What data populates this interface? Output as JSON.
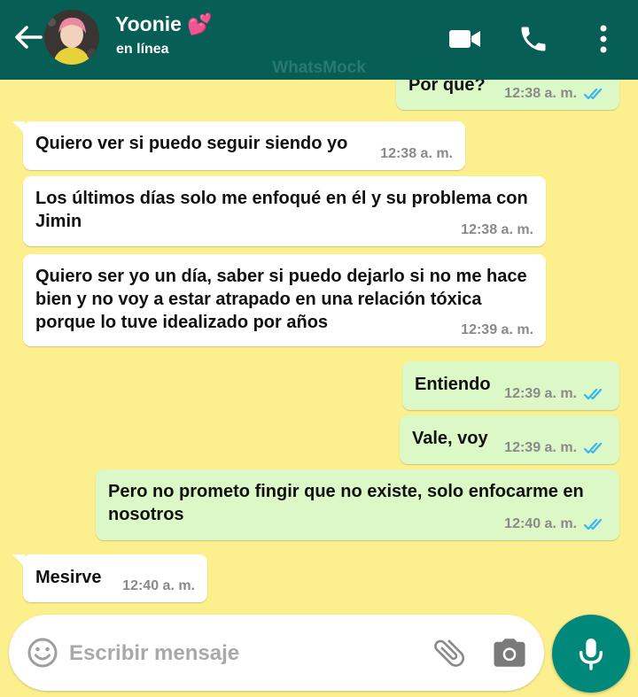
{
  "header": {
    "contact_name": "Yoonie 💕",
    "status": "en línea",
    "watermark": "WhatsMock"
  },
  "messages": [
    {
      "direction": "out",
      "text": "Por que?",
      "time": "12:38 a. m.",
      "read": true
    },
    {
      "direction": "in",
      "text": "Quiero ver si puedo seguir siendo yo",
      "time": "12:38 a. m."
    },
    {
      "direction": "in",
      "text": "Los últimos días solo me enfoqué en él y su problema con Jimin",
      "time": "12:38 a. m."
    },
    {
      "direction": "in",
      "text": "Quiero ser yo un día, saber si puedo dejarlo si no me hace bien y no voy a estar atrapado en una relación tóxica porque lo tuve idealizado por años",
      "time": "12:39 a. m."
    },
    {
      "direction": "out",
      "text": "Entiendo",
      "time": "12:39 a. m.",
      "read": true
    },
    {
      "direction": "out",
      "text": "Vale, voy",
      "time": "12:39 a. m.",
      "read": true
    },
    {
      "direction": "out",
      "text": "Pero no prometo fingir que no existe, solo enfocarme en nosotros",
      "time": "12:40 a. m.",
      "read": true
    },
    {
      "direction": "in",
      "text": "Mesirve",
      "time": "12:40 a. m."
    }
  ],
  "composer": {
    "placeholder": "Escribir mensaje"
  },
  "icons": {
    "back": "arrow-left-icon",
    "video": "video-camera-icon",
    "call": "phone-icon",
    "menu": "more-vert-icon",
    "emoji": "emoji-icon",
    "attach": "paperclip-icon",
    "camera": "camera-icon",
    "mic": "microphone-icon"
  },
  "colors": {
    "header": "#075e54",
    "chat_background": "#fcef8e",
    "incoming_bubble": "#ffffff",
    "outgoing_bubble": "#dcf8c6",
    "read_ticks": "#34b7f1",
    "mic_button": "#00897b"
  }
}
